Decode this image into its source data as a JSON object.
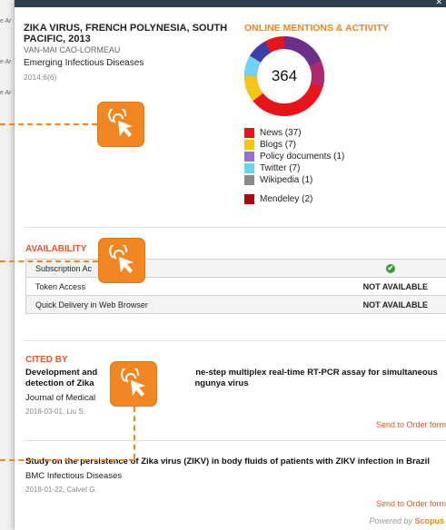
{
  "background_peek": [
    "e Ar",
    "e Ar",
    "e Ar"
  ],
  "article": {
    "title": "ZIKA VIRUS, FRENCH POLYNESIA, SOUTH PACIFIC, 2013",
    "author": "VAN-MAI CAO-LORMEAU",
    "journal": "Emerging Infectious Diseases",
    "date": "2014;6(6)"
  },
  "online_mentions": {
    "title": "ONLINE MENTIONS & ACTIVITY",
    "score": "364",
    "legend": [
      {
        "label": "News (37)",
        "color": "#e8141a",
        "value": 37
      },
      {
        "label": "Blogs (7)",
        "color": "#f5c518",
        "value": 7
      },
      {
        "label": "Policy documents (1)",
        "color": "#9b6bd8",
        "value": 1
      },
      {
        "label": "Twitter (7)",
        "color": "#6ed2f0",
        "value": 7
      },
      {
        "label": "Wikipedia (1)",
        "color": "#8a8a8a",
        "value": 1
      }
    ],
    "mendeley": {
      "label": "Mendeley (2)",
      "color": "#a30d0d"
    }
  },
  "availability": {
    "title": "AVAILABILITY",
    "rows": [
      {
        "label": "Subscription Ac",
        "status": "",
        "available": true
      },
      {
        "label": "Token Access",
        "status": "NOT AVAILABLE",
        "available": false
      },
      {
        "label": "Quick Delivery in Web Browser",
        "status": "NOT AVAILABLE",
        "available": false
      }
    ]
  },
  "cited_by": {
    "title": "CITED BY",
    "items": [
      {
        "title_left": "Development and",
        "title_right": "ne-step multiplex real-time RT-PCR assay for simultaneous",
        "title_line2_left": "detection of Zika",
        "title_line2_right": "ngunya virus",
        "journal": "Journal of Medical",
        "date": "2018-03-01, Liu S.",
        "action": "Send to Order form"
      },
      {
        "title": "Study on the persistence of Zika virus (ZIKV) in body fluids of patients with ZIKV infection in Brazil",
        "journal": "BMC Infectious Diseases",
        "date": "2018-01-22, Calvet G.",
        "action": "Send to Order form"
      }
    ]
  },
  "powered_by": {
    "prefix": "Powered by",
    "brand": "Scopus"
  },
  "colors": {
    "accent": "#f08721",
    "section": "#e05a2b",
    "ok": "#3a9a3a"
  }
}
